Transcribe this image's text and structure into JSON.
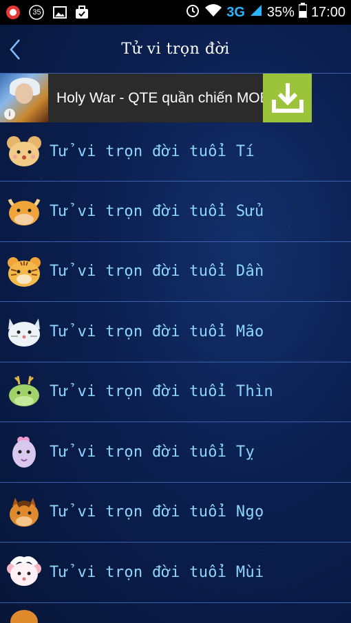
{
  "status_bar": {
    "notification_count": "35",
    "network": "3G",
    "battery": "35%",
    "time": "17:00"
  },
  "header": {
    "title": "Tử vi trọn đời"
  },
  "ad": {
    "title": "Holy War - QTE quần chiến MOBA",
    "info_glyph": "i",
    "download_color": "#9cc43a"
  },
  "list": {
    "items": [
      {
        "label": "Tử vi trọn đời tuổi Tí",
        "icon": "rat-icon"
      },
      {
        "label": "Tử vi trọn đời tuổi Sửu",
        "icon": "ox-icon"
      },
      {
        "label": "Tử vi trọn đời tuổi Dần",
        "icon": "tiger-icon"
      },
      {
        "label": "Tử vi trọn đời tuổi Mão",
        "icon": "cat-icon"
      },
      {
        "label": "Tử vi trọn đời tuổi Thìn",
        "icon": "dragon-icon"
      },
      {
        "label": "Tử vi trọn đời tuổi Tỵ",
        "icon": "snake-icon"
      },
      {
        "label": "Tử vi trọn đời tuổi Ngọ",
        "icon": "horse-icon"
      },
      {
        "label": "Tử vi trọn đời tuổi Mùi",
        "icon": "goat-icon"
      }
    ]
  },
  "colors": {
    "accent_label": "#8fd6ff",
    "divider": "#3c5fb0",
    "background": "#0b1f4f"
  }
}
